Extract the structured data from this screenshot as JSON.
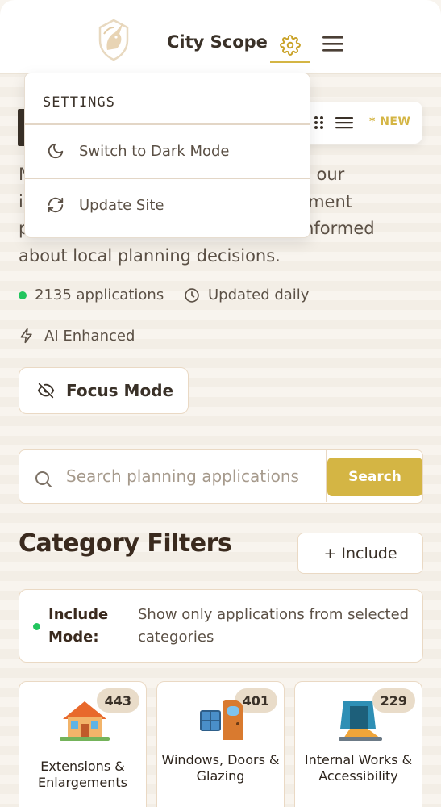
{
  "header": {
    "title": "City Scope",
    "logo_icon": "unicorn-logo",
    "settings_icon": "gear-icon",
    "menu_icon": "hamburger-menu-icon",
    "accent_color": "#d4b544"
  },
  "settings_menu": {
    "header": "SETTINGS",
    "items": [
      {
        "label": "Switch to Dark Mode",
        "icon": "moon-icon"
      },
      {
        "label": "Update Site",
        "icon": "refresh-icon"
      }
    ]
  },
  "hero": {
    "intro_lines": [
      "N                                                     our",
      "i                                                 opment",
      "p                                            tay informed",
      "about local planning decisions."
    ],
    "view_toggle": {
      "new_label": "* NEW"
    },
    "stats": {
      "applications": "2135 applications",
      "updated": "Updated daily",
      "ai": "AI Enhanced"
    },
    "focus_mode_label": "Focus Mode"
  },
  "search": {
    "placeholder": "Search planning applications",
    "button_label": "Search"
  },
  "filters": {
    "title": "Category Filters",
    "include_button": "+ Include",
    "mode_label": "Include Mode:",
    "mode_description": "Show only applications from selected categories",
    "categories": [
      {
        "label": "Extensions & Enlargements",
        "count": "443",
        "icon": "house-icon"
      },
      {
        "label": "Windows, Doors & Glazing",
        "count": "401",
        "icon": "door-window-icon"
      },
      {
        "label": "Internal Works & Accessibility",
        "count": "229",
        "icon": "doorway-ramp-icon"
      }
    ]
  }
}
